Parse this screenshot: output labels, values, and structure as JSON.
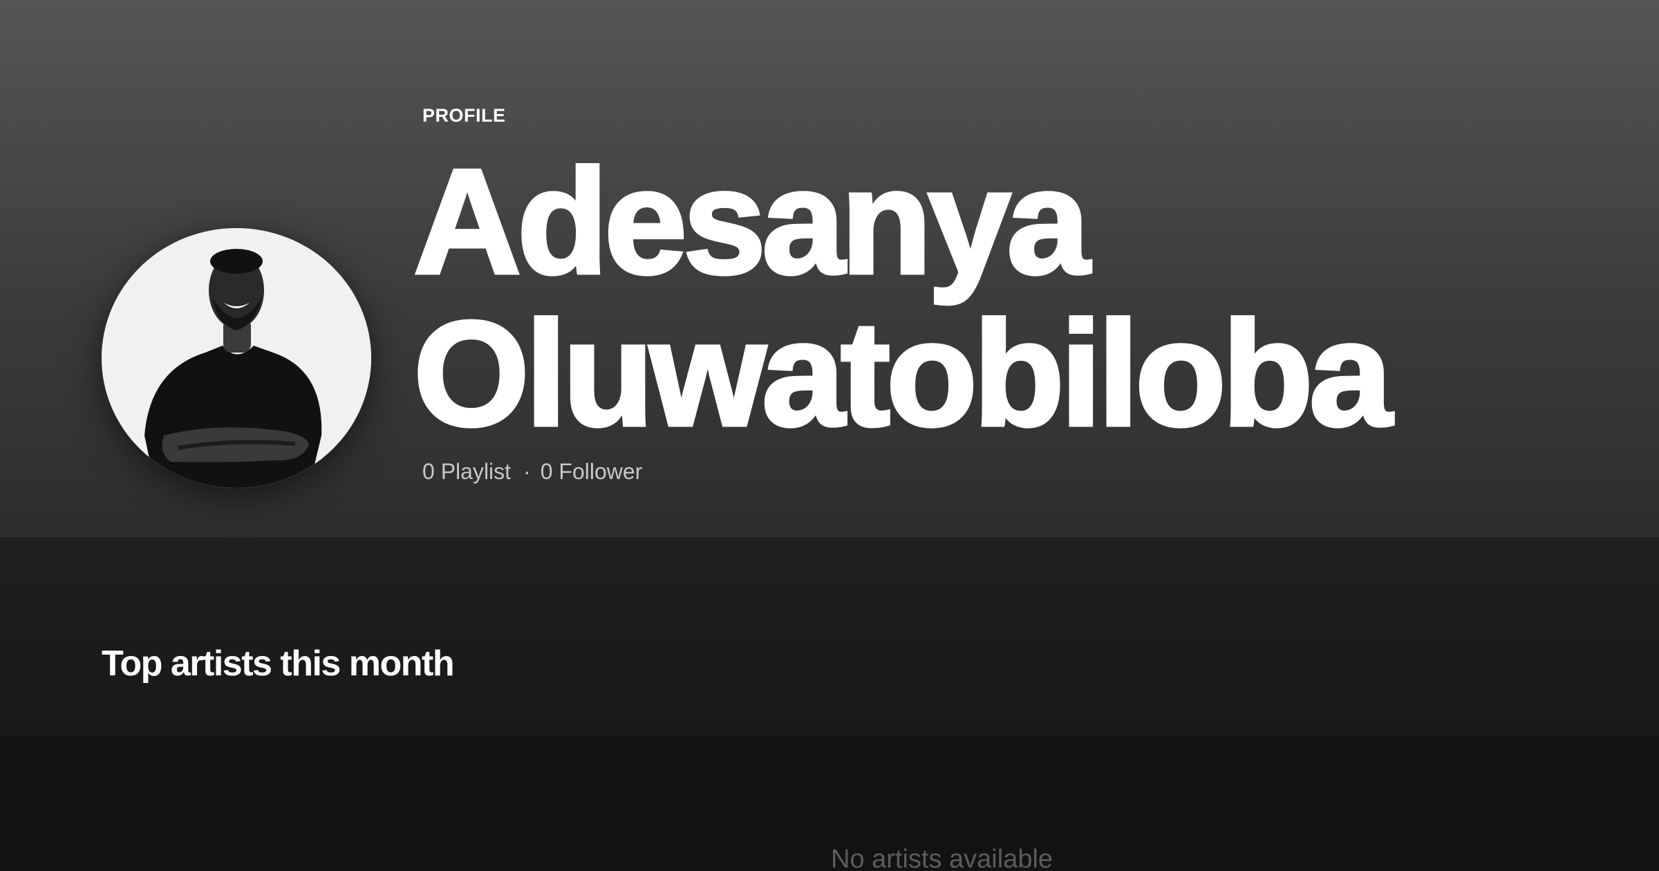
{
  "profile": {
    "type_label": "PROFILE",
    "name_line1": "Adesanya",
    "name_line2": "Oluwatobiloba",
    "playlists": "0 Playlist",
    "separator": "·",
    "followers": "0 Follower",
    "avatar_alt": "Profile photo"
  },
  "top_artists": {
    "title": "Top artists this month",
    "empty_message": "No artists available"
  }
}
